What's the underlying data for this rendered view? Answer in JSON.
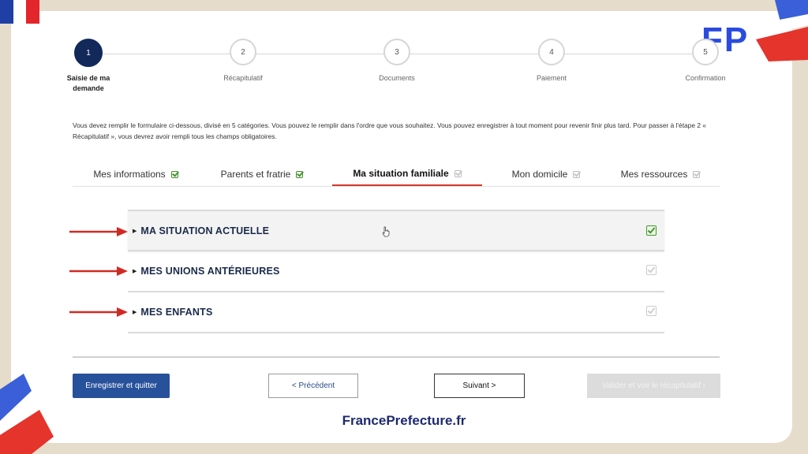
{
  "flag_colors": [
    "#1f3fa6",
    "#ffffff",
    "#e2262b"
  ],
  "logo": {
    "text": "FP",
    "color": "#2a4be0"
  },
  "stepper": [
    {
      "number": "1",
      "label": "Saisie de ma demande",
      "active": true
    },
    {
      "number": "2",
      "label": "Récapitulatif",
      "active": false
    },
    {
      "number": "3",
      "label": "Documents",
      "active": false
    },
    {
      "number": "4",
      "label": "Paiement",
      "active": false
    },
    {
      "number": "5",
      "label": "Confirmation",
      "active": false
    }
  ],
  "intro_text": "Vous devez remplir le formulaire ci-dessous, divisé en 5 catégories. Vous pouvez le remplir dans l'ordre que vous souhaitez. Vous pouvez enregistrer à tout moment pour revenir finir plus tard. Pour passer à l'étape 2 « Récapitulatif », vous devrez avoir rempli tous les champs obligatoires.",
  "tabs": [
    {
      "label": "Mes informations",
      "checked": true,
      "active": false
    },
    {
      "label": "Parents et fratrie",
      "checked": true,
      "active": false
    },
    {
      "label": "Ma situation familiale",
      "checked": false,
      "active": true
    },
    {
      "label": "Mon domicile",
      "checked": false,
      "active": false
    },
    {
      "label": "Mes ressources",
      "checked": false,
      "active": false
    }
  ],
  "sections": [
    {
      "title": "MA SITUATION ACTUELLE",
      "checked": true
    },
    {
      "title": "MES UNIONS ANTÉRIEURES",
      "checked": false
    },
    {
      "title": "MES ENFANTS",
      "checked": false
    }
  ],
  "buttons": {
    "save": "Enregistrer et quitter",
    "previous": "< Précédent",
    "next": "Suivant >",
    "validate": "Valider et voir le récapitulatif ›"
  },
  "footer": "FrancePrefecture.fr",
  "accent_colors": {
    "active_step": "#12295a",
    "tab_underline": "#d23a2a",
    "arrow": "#d12a22",
    "primary_button": "#27519a"
  }
}
